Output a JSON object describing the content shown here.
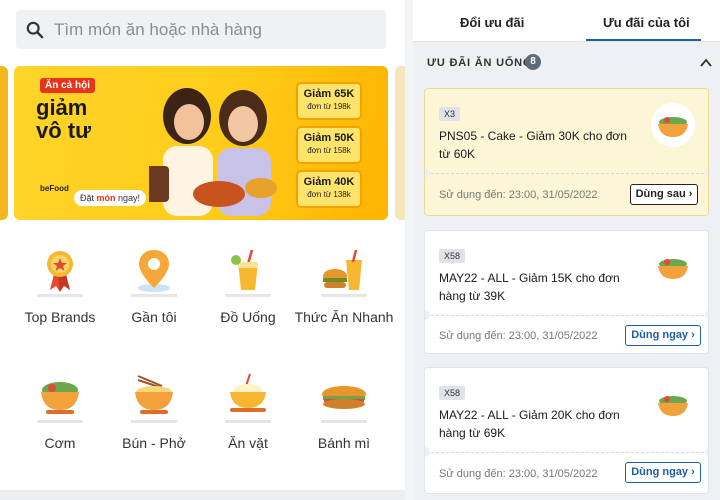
{
  "search": {
    "placeholder": "Tìm món ăn hoặc nhà hàng"
  },
  "banner": {
    "tag": "Ăn cả hội",
    "headline": "giảm vô tư",
    "cta_prefix": "Đặt ",
    "cta_bold": "món",
    "cta_suffix": " ngay!",
    "brand": "beFood",
    "coupons": [
      {
        "amount": "Giảm 65K",
        "condition": "đơn từ 198k"
      },
      {
        "amount": "Giảm 50K",
        "condition": "đơn từ 158k"
      },
      {
        "amount": "Giảm 40K",
        "condition": "đơn từ 138k"
      }
    ]
  },
  "categories": [
    {
      "label": "Top Brands",
      "icon": "medal-icon"
    },
    {
      "label": "Gần tôi",
      "icon": "location-pin-icon"
    },
    {
      "label": "Đồ Uống",
      "icon": "drink-icon"
    },
    {
      "label": "Thức Ăn Nhanh",
      "icon": "fast-food-icon"
    },
    {
      "label": "Cơm",
      "icon": "rice-bowl-icon"
    },
    {
      "label": "Bún - Phở",
      "icon": "noodle-bowl-icon"
    },
    {
      "label": "Ăn vặt",
      "icon": "snack-icon"
    },
    {
      "label": "Bánh mì",
      "icon": "banh-mi-icon"
    }
  ],
  "tabs": [
    {
      "label": "Đổi ưu đãi",
      "active": false
    },
    {
      "label": "Ưu đãi của tôi",
      "active": true
    }
  ],
  "section": {
    "title": "ƯU ĐÃI ĂN UỐNG",
    "count": "8"
  },
  "vouchers": [
    {
      "qty": "X3",
      "description": "PNS05 - Cake - Giảm 30K cho đơn từ 60K",
      "valid_until": "Sử dụng đến: 23:00, 31/05/2022",
      "button": "Dùng sau ›",
      "highlighted": true
    },
    {
      "qty": "X58",
      "description": "MAY22 - ALL - Giảm 15K cho đơn hàng từ 39K",
      "valid_until": "Sử dụng đến: 23:00, 31/05/2022",
      "button": "Dùng ngay ›",
      "highlighted": false
    },
    {
      "qty": "X58",
      "description": "MAY22 - ALL - Giảm 20K cho đơn hàng từ 69K",
      "valid_until": "Sử dụng đến: 23:00, 31/05/2022",
      "button": "Dùng ngay ›",
      "highlighted": false
    }
  ],
  "colors": {
    "accent_blue": "#1d5fa8",
    "banner_yellow": "#ffcc1a",
    "highlight_card": "#fcf6d6"
  }
}
